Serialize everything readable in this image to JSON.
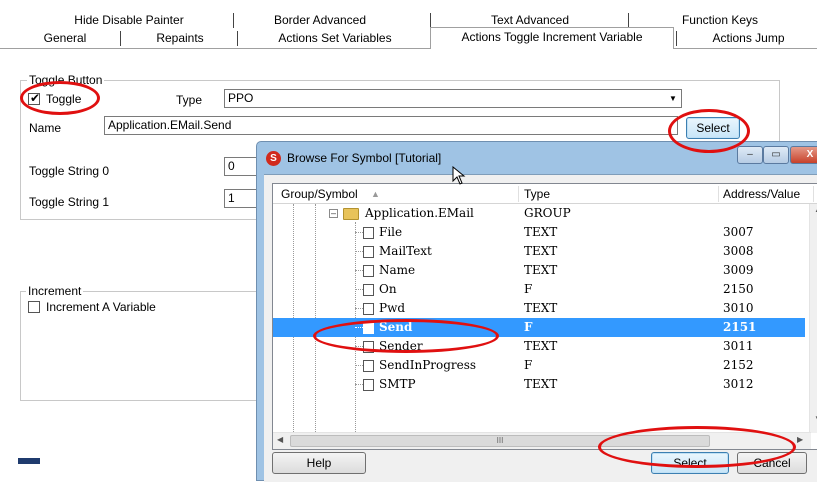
{
  "tabs": {
    "row1": [
      "Hide Disable Painter",
      "Border Advanced",
      "Text Advanced",
      "Function Keys"
    ],
    "row2": [
      "General",
      "Repaints",
      "Actions Set Variables",
      "Actions Toggle Increment Variable",
      "Actions Jump"
    ],
    "active": "Actions Toggle Increment Variable"
  },
  "toggle_group": {
    "title": "Toggle Button",
    "toggle_label": "Toggle",
    "toggle_checked": true,
    "type_label": "Type",
    "type_value": "PPO",
    "name_label": "Name",
    "name_value": "Application.EMail.Send",
    "select_label": "Select",
    "toggle_string_0_label": "Toggle String 0",
    "toggle_string_0_value": "0",
    "toggle_string_1_label": "Toggle String 1",
    "toggle_string_1_value": "1"
  },
  "increment_group": {
    "title": "Increment",
    "checkbox_label": "Increment A Variable",
    "checked": false
  },
  "dialog": {
    "title": "Browse For Symbol [Tutorial]",
    "columns": [
      "Group/Symbol",
      "Type",
      "Address/Value"
    ],
    "group": {
      "name": "Application.EMail",
      "type": "GROUP",
      "value": ""
    },
    "rows": [
      {
        "name": "File",
        "type": "TEXT",
        "value": "3007"
      },
      {
        "name": "MailText",
        "type": "TEXT",
        "value": "3008"
      },
      {
        "name": "Name",
        "type": "TEXT",
        "value": "3009"
      },
      {
        "name": "On",
        "type": "F",
        "value": "2150"
      },
      {
        "name": "Pwd",
        "type": "TEXT",
        "value": "3010"
      },
      {
        "name": "Send",
        "type": "F",
        "value": "2151",
        "selected": true
      },
      {
        "name": "Sender",
        "type": "TEXT",
        "value": "3011"
      },
      {
        "name": "SendInProgress",
        "type": "F",
        "value": "2152"
      },
      {
        "name": "SMTP",
        "type": "TEXT",
        "value": "3012"
      }
    ],
    "help_label": "Help",
    "select_label": "Select",
    "cancel_label": "Cancel",
    "hscroll_thumb_glyph": "III"
  },
  "icons": {
    "check_glyph": "✔",
    "dropdown_glyph": "▼",
    "sort_glyph": "▲",
    "minimize_glyph": "–",
    "maximize_glyph": "▭",
    "close_glyph": "X",
    "logo_glyph": "S",
    "folder_color": "#e8c35a",
    "highlight_color": "#3399ff",
    "annotation_color": "#e01010"
  }
}
